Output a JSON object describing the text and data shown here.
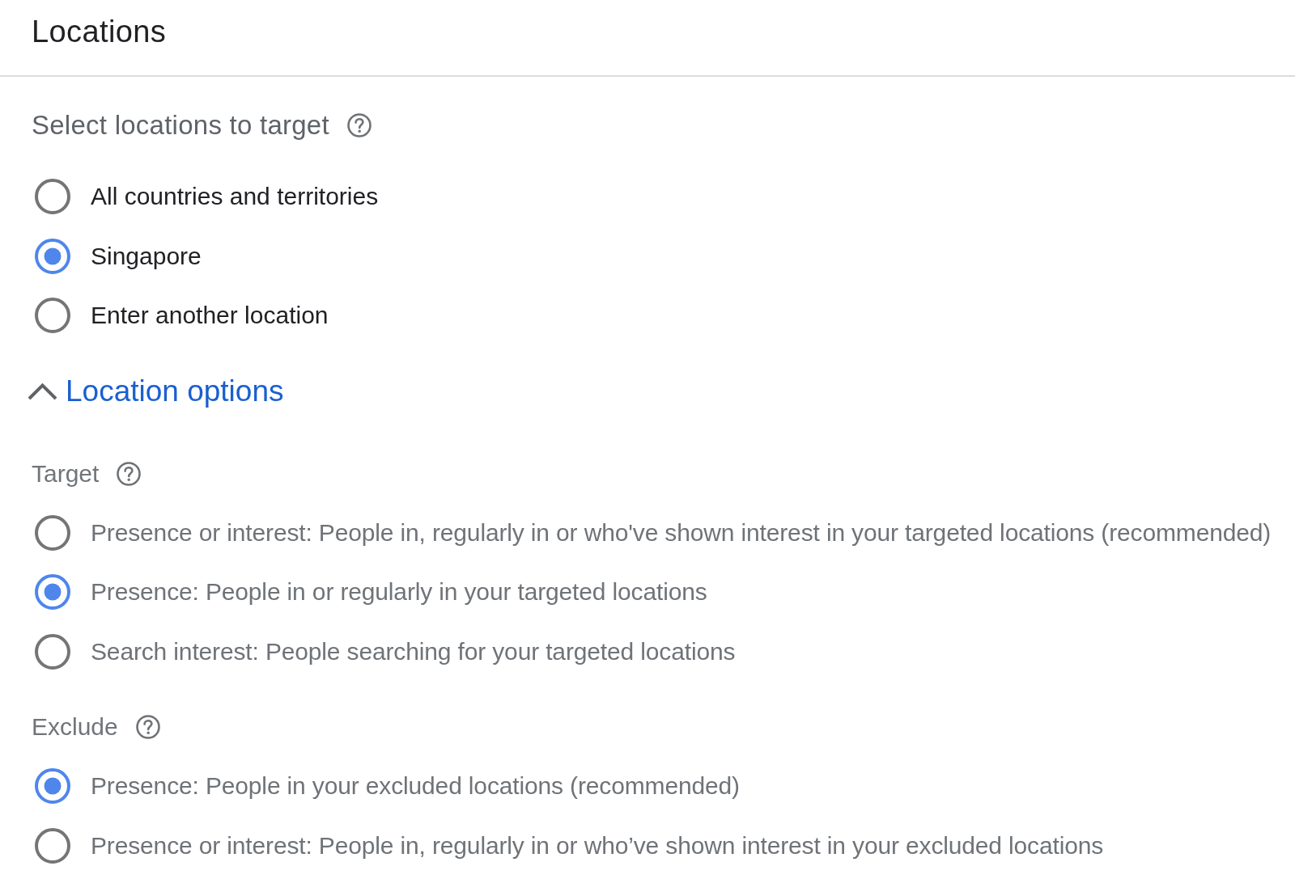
{
  "header": {
    "title": "Locations"
  },
  "location_targets": {
    "label": "Select locations to target",
    "options": [
      {
        "label": "All countries and territories",
        "selected": false
      },
      {
        "label": "Singapore",
        "selected": true
      },
      {
        "label": "Enter another location",
        "selected": false
      }
    ]
  },
  "location_options": {
    "label": "Location options",
    "expanded": true,
    "target": {
      "label": "Target",
      "options": [
        {
          "label": "Presence or interest: People in, regularly in or who've shown interest in your targeted locations (recommended)",
          "selected": false
        },
        {
          "label": "Presence: People in or regularly in your targeted locations",
          "selected": true
        },
        {
          "label": "Search interest: People searching for your targeted locations",
          "selected": false
        }
      ]
    },
    "exclude": {
      "label": "Exclude",
      "options": [
        {
          "label": "Presence: People in your excluded locations (recommended)",
          "selected": true
        },
        {
          "label": "Presence or interest: People in, regularly in or who’ve shown interest in your excluded locations",
          "selected": false
        }
      ]
    }
  }
}
